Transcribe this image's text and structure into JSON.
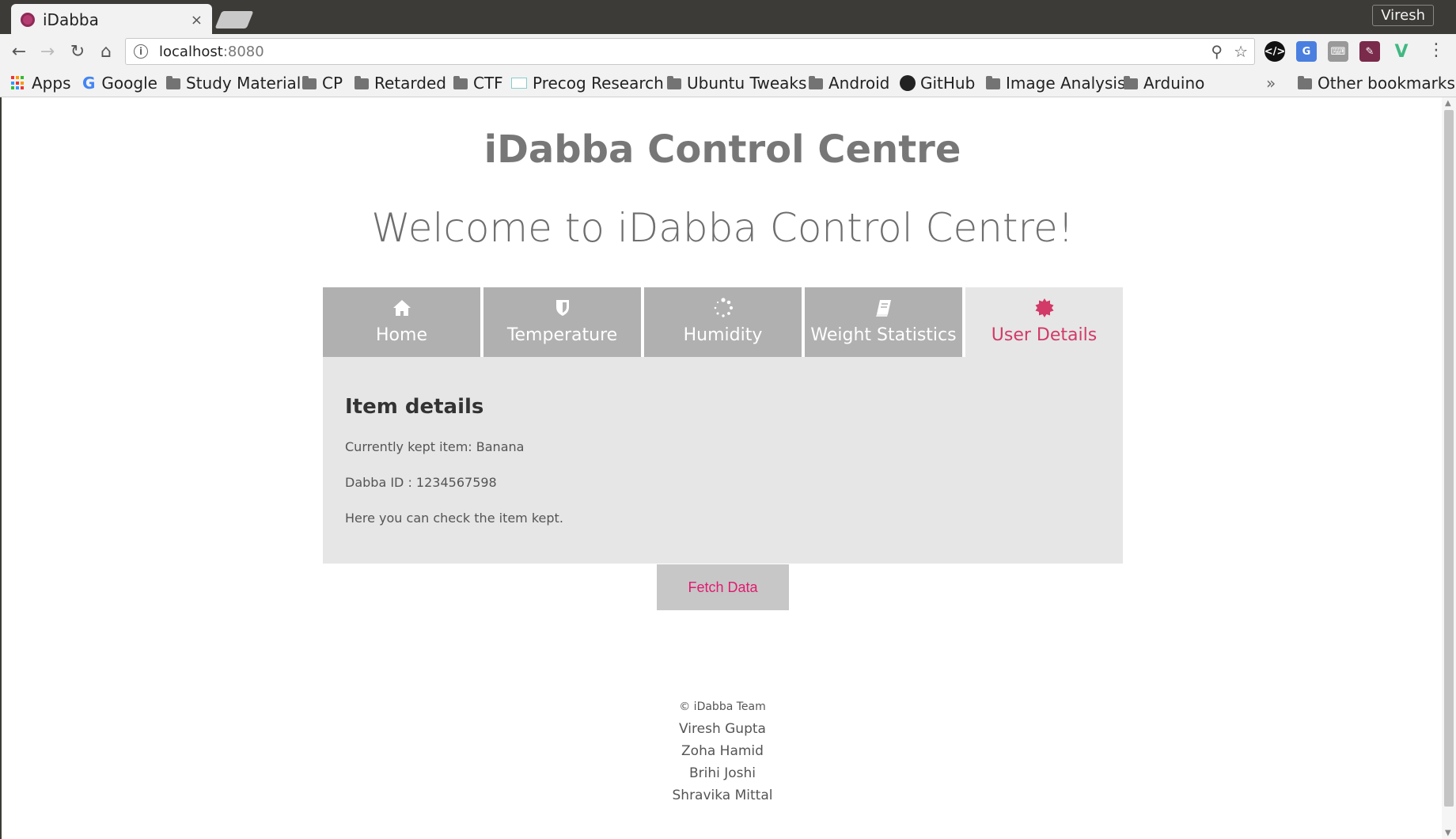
{
  "browser": {
    "tab_title": "iDabba",
    "tab_close": "×",
    "profile_name": "Viresh",
    "url_host": "localhost",
    "url_port": ":8080",
    "bookmarks": {
      "apps": "Apps",
      "google": "Google",
      "study": "Study Material",
      "cp": "CP",
      "retarded": "Retarded",
      "ctf": "CTF",
      "precog": "Precog Research",
      "ubuntu": "Ubuntu Tweaks",
      "android": "Android",
      "github": "GitHub",
      "image": "Image Analysis",
      "arduino": "Arduino",
      "overflow": "»",
      "other": "Other bookmarks"
    }
  },
  "page": {
    "title": "iDabba Control Centre",
    "welcome": "Welcome to iDabba Control Centre!",
    "tabs": [
      {
        "label": "Home",
        "icon": "home-icon"
      },
      {
        "label": "Temperature",
        "icon": "shield-icon"
      },
      {
        "label": "Humidity",
        "icon": "spinner-icon"
      },
      {
        "label": "Weight Statistics",
        "icon": "book-icon"
      },
      {
        "label": "User Details",
        "icon": "badge-icon",
        "active": true
      }
    ],
    "panel": {
      "heading": "Item details",
      "line1": "Currently kept item: Banana",
      "line2": "Dabba ID : 1234567598",
      "line3": "Here you can check the item kept."
    },
    "fetch_button": "Fetch Data",
    "footer": {
      "copyright": "© iDabba Team",
      "members": [
        "Viresh Gupta",
        "Zoha Hamid",
        "Brihi Joshi",
        "Shravika Mittal"
      ]
    }
  },
  "colors": {
    "accent": "#d23a68",
    "button_text": "#e21a70",
    "tab_bg": "#b0b0b0",
    "panel_bg": "#e6e6e6"
  }
}
